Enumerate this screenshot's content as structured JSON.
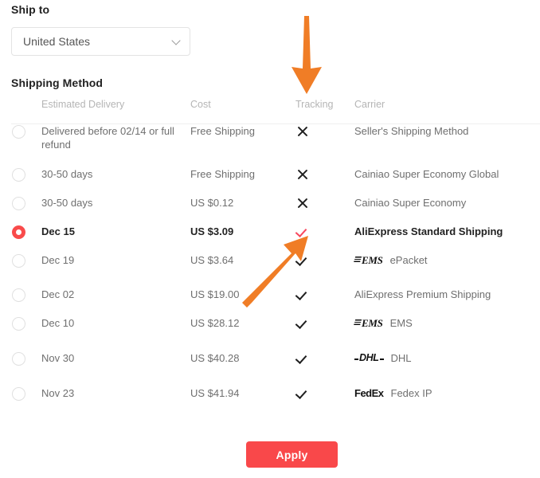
{
  "ship_to": {
    "label": "Ship to",
    "selected_country": "United States",
    "chevron_icon": "chevron-down-icon"
  },
  "shipping_method": {
    "label": "Shipping Method",
    "columns": {
      "delivery": "Estimated Delivery",
      "cost": "Cost",
      "tracking": "Tracking",
      "carrier": "Carrier"
    },
    "rows": [
      {
        "delivery": "Delivered before 02/14 or full refund",
        "cost": "Free Shipping",
        "tracking": "x",
        "carrier": "Seller's Shipping Method",
        "logo": "",
        "selected": false
      },
      {
        "delivery": "30-50 days",
        "cost": "Free Shipping",
        "tracking": "x",
        "carrier": "Cainiao Super Economy Global",
        "logo": "",
        "selected": false
      },
      {
        "delivery": "30-50 days",
        "cost": "US $0.12",
        "tracking": "x",
        "carrier": "Cainiao Super Economy",
        "logo": "",
        "selected": false
      },
      {
        "delivery": "Dec 15",
        "cost": "US $3.09",
        "tracking": "check",
        "carrier": "AliExpress Standard Shipping",
        "logo": "",
        "selected": true
      },
      {
        "delivery": "Dec 19",
        "cost": "US $3.64",
        "tracking": "check",
        "carrier": "ePacket",
        "logo": "EMS",
        "selected": false
      },
      {
        "delivery": "Dec 02",
        "cost": "US $19.00",
        "tracking": "check",
        "carrier": "AliExpress Premium Shipping",
        "logo": "",
        "selected": false
      },
      {
        "delivery": "Dec 10",
        "cost": "US $28.12",
        "tracking": "check",
        "carrier": "EMS",
        "logo": "EMS",
        "selected": false
      },
      {
        "delivery": "Nov 30",
        "cost": "US $40.28",
        "tracking": "check",
        "carrier": "DHL",
        "logo": "DHL",
        "selected": false
      },
      {
        "delivery": "Nov 23",
        "cost": "US $41.94",
        "tracking": "check",
        "carrier": "Fedex IP",
        "logo": "FedEx",
        "selected": false
      }
    ]
  },
  "apply": {
    "label": "Apply"
  },
  "annotations": {
    "arrow_down": "orange-down-arrow-annotation",
    "arrow_diagonal": "orange-diagonal-arrow-annotation"
  },
  "colors": {
    "accent_red": "#f9484a",
    "selected_radio": "#f94b4b",
    "selected_check": "#f8485e",
    "annotation_orange": "#f07d26"
  }
}
